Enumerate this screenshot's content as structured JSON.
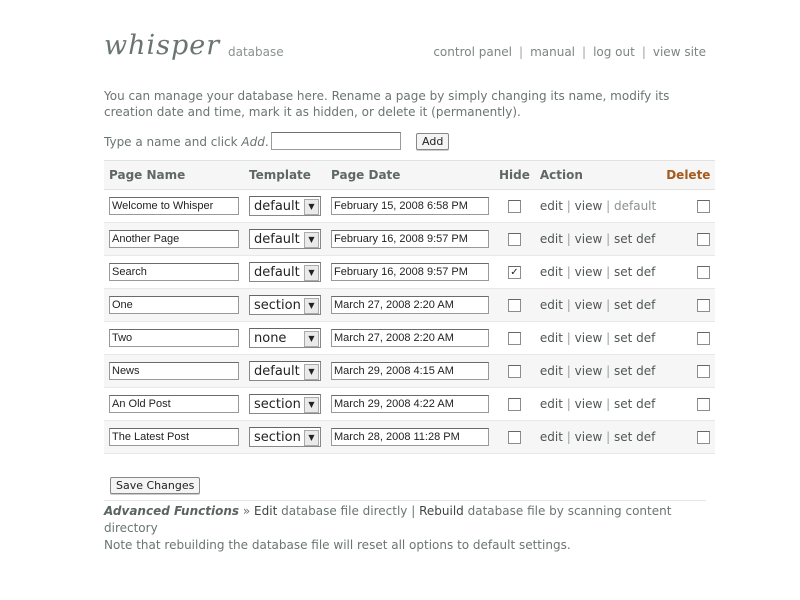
{
  "header": {
    "logo": "whisper",
    "subtitle": "database",
    "nav": [
      {
        "label": "control panel"
      },
      {
        "label": "manual"
      },
      {
        "label": "log out"
      },
      {
        "label": "view site"
      }
    ],
    "nav_sep": "|"
  },
  "intro": "You can manage your database here. Rename a page by simply changing its name, modify its creation date and time, mark it as hidden, or delete it (permanently).",
  "add": {
    "label_prefix": "Type a name and click ",
    "label_em": "Add",
    "label_suffix": ".",
    "input_value": "",
    "button": "Add"
  },
  "table": {
    "headers": {
      "name": "Page Name",
      "template": "Template",
      "date": "Page Date",
      "hide": "Hide",
      "action": "Action",
      "delete": "Delete"
    },
    "rows": [
      {
        "name": "Welcome to Whisper",
        "template": "default",
        "date": "February 15, 2008 6:58 PM",
        "hidden": false,
        "edit": "edit",
        "view": "view",
        "setdef": "default",
        "is_default": true,
        "delete": false
      },
      {
        "name": "Another Page",
        "template": "default",
        "date": "February 16, 2008 9:57 PM",
        "hidden": false,
        "edit": "edit",
        "view": "view",
        "setdef": "set def",
        "is_default": false,
        "delete": false
      },
      {
        "name": "Search",
        "template": "default",
        "date": "February 16, 2008 9:57 PM",
        "hidden": true,
        "edit": "edit",
        "view": "view",
        "setdef": "set def",
        "is_default": false,
        "delete": false
      },
      {
        "name": "One",
        "template": "section",
        "date": "March 27, 2008 2:20 AM",
        "hidden": false,
        "edit": "edit",
        "view": "view",
        "setdef": "set def",
        "is_default": false,
        "delete": false
      },
      {
        "name": "Two",
        "template": "none",
        "date": "March 27, 2008 2:20 AM",
        "hidden": false,
        "edit": "edit",
        "view": "view",
        "setdef": "set def",
        "is_default": false,
        "delete": false
      },
      {
        "name": "News",
        "template": "default",
        "date": "March 29, 2008 4:15 AM",
        "hidden": false,
        "edit": "edit",
        "view": "view",
        "setdef": "set def",
        "is_default": false,
        "delete": false
      },
      {
        "name": "An Old Post",
        "template": "section",
        "date": "March 29, 2008 4:22 AM",
        "hidden": false,
        "edit": "edit",
        "view": "view",
        "setdef": "set def",
        "is_default": false,
        "delete": false
      },
      {
        "name": "The Latest Post",
        "template": "section",
        "date": "March 28, 2008 11:28 PM",
        "hidden": false,
        "edit": "edit",
        "view": "view",
        "setdef": "set def",
        "is_default": false,
        "delete": false
      }
    ],
    "action_sep": "|",
    "check_glyph": "✓",
    "arrow_glyph": "▼"
  },
  "save_button": "Save Changes",
  "advanced": {
    "title": "Advanced Functions",
    "arrow": "»",
    "edit_label": "Edit",
    "edit_text": "database file directly",
    "sep": "|",
    "rebuild_label": "Rebuild",
    "rebuild_text": "database file by scanning content directory",
    "note": "Note that rebuilding the database file will reset all options to default settings."
  },
  "colors": {
    "delete_header": "#a45a1c",
    "row_alt_bg": "#f6f6f6",
    "text": "#6a7570"
  }
}
